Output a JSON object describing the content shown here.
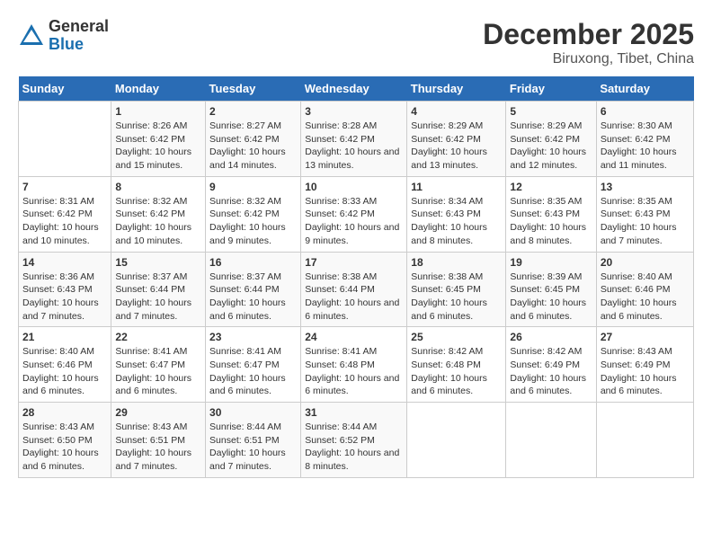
{
  "logo": {
    "general": "General",
    "blue": "Blue"
  },
  "title": "December 2025",
  "subtitle": "Biruxong, Tibet, China",
  "days_of_week": [
    "Sunday",
    "Monday",
    "Tuesday",
    "Wednesday",
    "Thursday",
    "Friday",
    "Saturday"
  ],
  "weeks": [
    [
      {
        "num": "",
        "sunrise": "",
        "sunset": "",
        "daylight": ""
      },
      {
        "num": "1",
        "sunrise": "Sunrise: 8:26 AM",
        "sunset": "Sunset: 6:42 PM",
        "daylight": "Daylight: 10 hours and 15 minutes."
      },
      {
        "num": "2",
        "sunrise": "Sunrise: 8:27 AM",
        "sunset": "Sunset: 6:42 PM",
        "daylight": "Daylight: 10 hours and 14 minutes."
      },
      {
        "num": "3",
        "sunrise": "Sunrise: 8:28 AM",
        "sunset": "Sunset: 6:42 PM",
        "daylight": "Daylight: 10 hours and 13 minutes."
      },
      {
        "num": "4",
        "sunrise": "Sunrise: 8:29 AM",
        "sunset": "Sunset: 6:42 PM",
        "daylight": "Daylight: 10 hours and 13 minutes."
      },
      {
        "num": "5",
        "sunrise": "Sunrise: 8:29 AM",
        "sunset": "Sunset: 6:42 PM",
        "daylight": "Daylight: 10 hours and 12 minutes."
      },
      {
        "num": "6",
        "sunrise": "Sunrise: 8:30 AM",
        "sunset": "Sunset: 6:42 PM",
        "daylight": "Daylight: 10 hours and 11 minutes."
      }
    ],
    [
      {
        "num": "7",
        "sunrise": "Sunrise: 8:31 AM",
        "sunset": "Sunset: 6:42 PM",
        "daylight": "Daylight: 10 hours and 10 minutes."
      },
      {
        "num": "8",
        "sunrise": "Sunrise: 8:32 AM",
        "sunset": "Sunset: 6:42 PM",
        "daylight": "Daylight: 10 hours and 10 minutes."
      },
      {
        "num": "9",
        "sunrise": "Sunrise: 8:32 AM",
        "sunset": "Sunset: 6:42 PM",
        "daylight": "Daylight: 10 hours and 9 minutes."
      },
      {
        "num": "10",
        "sunrise": "Sunrise: 8:33 AM",
        "sunset": "Sunset: 6:42 PM",
        "daylight": "Daylight: 10 hours and 9 minutes."
      },
      {
        "num": "11",
        "sunrise": "Sunrise: 8:34 AM",
        "sunset": "Sunset: 6:43 PM",
        "daylight": "Daylight: 10 hours and 8 minutes."
      },
      {
        "num": "12",
        "sunrise": "Sunrise: 8:35 AM",
        "sunset": "Sunset: 6:43 PM",
        "daylight": "Daylight: 10 hours and 8 minutes."
      },
      {
        "num": "13",
        "sunrise": "Sunrise: 8:35 AM",
        "sunset": "Sunset: 6:43 PM",
        "daylight": "Daylight: 10 hours and 7 minutes."
      }
    ],
    [
      {
        "num": "14",
        "sunrise": "Sunrise: 8:36 AM",
        "sunset": "Sunset: 6:43 PM",
        "daylight": "Daylight: 10 hours and 7 minutes."
      },
      {
        "num": "15",
        "sunrise": "Sunrise: 8:37 AM",
        "sunset": "Sunset: 6:44 PM",
        "daylight": "Daylight: 10 hours and 7 minutes."
      },
      {
        "num": "16",
        "sunrise": "Sunrise: 8:37 AM",
        "sunset": "Sunset: 6:44 PM",
        "daylight": "Daylight: 10 hours and 6 minutes."
      },
      {
        "num": "17",
        "sunrise": "Sunrise: 8:38 AM",
        "sunset": "Sunset: 6:44 PM",
        "daylight": "Daylight: 10 hours and 6 minutes."
      },
      {
        "num": "18",
        "sunrise": "Sunrise: 8:38 AM",
        "sunset": "Sunset: 6:45 PM",
        "daylight": "Daylight: 10 hours and 6 minutes."
      },
      {
        "num": "19",
        "sunrise": "Sunrise: 8:39 AM",
        "sunset": "Sunset: 6:45 PM",
        "daylight": "Daylight: 10 hours and 6 minutes."
      },
      {
        "num": "20",
        "sunrise": "Sunrise: 8:40 AM",
        "sunset": "Sunset: 6:46 PM",
        "daylight": "Daylight: 10 hours and 6 minutes."
      }
    ],
    [
      {
        "num": "21",
        "sunrise": "Sunrise: 8:40 AM",
        "sunset": "Sunset: 6:46 PM",
        "daylight": "Daylight: 10 hours and 6 minutes."
      },
      {
        "num": "22",
        "sunrise": "Sunrise: 8:41 AM",
        "sunset": "Sunset: 6:47 PM",
        "daylight": "Daylight: 10 hours and 6 minutes."
      },
      {
        "num": "23",
        "sunrise": "Sunrise: 8:41 AM",
        "sunset": "Sunset: 6:47 PM",
        "daylight": "Daylight: 10 hours and 6 minutes."
      },
      {
        "num": "24",
        "sunrise": "Sunrise: 8:41 AM",
        "sunset": "Sunset: 6:48 PM",
        "daylight": "Daylight: 10 hours and 6 minutes."
      },
      {
        "num": "25",
        "sunrise": "Sunrise: 8:42 AM",
        "sunset": "Sunset: 6:48 PM",
        "daylight": "Daylight: 10 hours and 6 minutes."
      },
      {
        "num": "26",
        "sunrise": "Sunrise: 8:42 AM",
        "sunset": "Sunset: 6:49 PM",
        "daylight": "Daylight: 10 hours and 6 minutes."
      },
      {
        "num": "27",
        "sunrise": "Sunrise: 8:43 AM",
        "sunset": "Sunset: 6:49 PM",
        "daylight": "Daylight: 10 hours and 6 minutes."
      }
    ],
    [
      {
        "num": "28",
        "sunrise": "Sunrise: 8:43 AM",
        "sunset": "Sunset: 6:50 PM",
        "daylight": "Daylight: 10 hours and 6 minutes."
      },
      {
        "num": "29",
        "sunrise": "Sunrise: 8:43 AM",
        "sunset": "Sunset: 6:51 PM",
        "daylight": "Daylight: 10 hours and 7 minutes."
      },
      {
        "num": "30",
        "sunrise": "Sunrise: 8:44 AM",
        "sunset": "Sunset: 6:51 PM",
        "daylight": "Daylight: 10 hours and 7 minutes."
      },
      {
        "num": "31",
        "sunrise": "Sunrise: 8:44 AM",
        "sunset": "Sunset: 6:52 PM",
        "daylight": "Daylight: 10 hours and 8 minutes."
      },
      {
        "num": "",
        "sunrise": "",
        "sunset": "",
        "daylight": ""
      },
      {
        "num": "",
        "sunrise": "",
        "sunset": "",
        "daylight": ""
      },
      {
        "num": "",
        "sunrise": "",
        "sunset": "",
        "daylight": ""
      }
    ]
  ]
}
